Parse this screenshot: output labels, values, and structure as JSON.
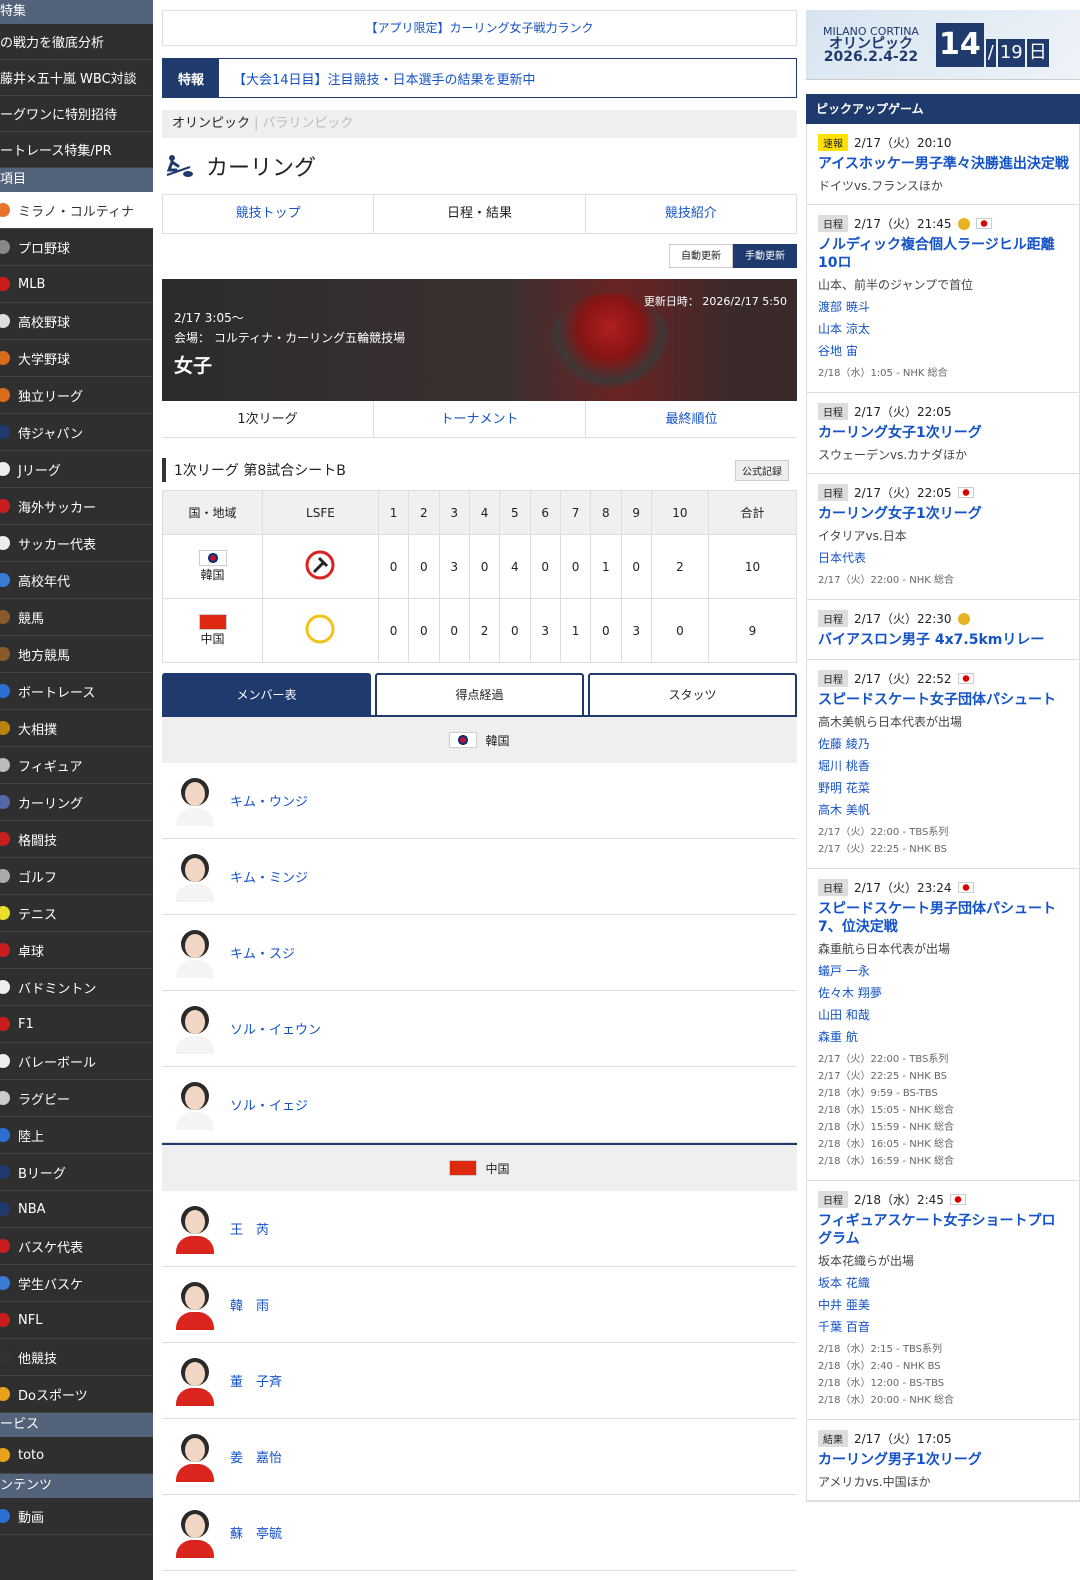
{
  "sidebar": {
    "head1": "特集",
    "features": [
      "の戦力を徹底分析",
      "藤井×五十嵐 WBC対談",
      "ーグワンに特別招待",
      "ートレース特集/PR"
    ],
    "head2": "項目",
    "items": [
      {
        "label": "ミラノ・コルティナ",
        "color": "#e8732a",
        "active": true
      },
      {
        "label": "プロ野球",
        "color": "#888"
      },
      {
        "label": "MLB",
        "color": "#c81e1e"
      },
      {
        "label": "高校野球",
        "color": "#ddd"
      },
      {
        "label": "大学野球",
        "color": "#d96c1c"
      },
      {
        "label": "独立リーグ",
        "color": "#d96c1c"
      },
      {
        "label": "侍ジャパン",
        "color": "#1f3a6d"
      },
      {
        "label": "Jリーグ",
        "color": "#eee"
      },
      {
        "label": "海外サッカー",
        "color": "#c81e1e"
      },
      {
        "label": "サッカー代表",
        "color": "#eee"
      },
      {
        "label": "高校年代",
        "color": "#3a7bd5"
      },
      {
        "label": "競馬",
        "color": "#8b5a2b"
      },
      {
        "label": "地方競馬",
        "color": "#8b5a2b"
      },
      {
        "label": "ボートレース",
        "color": "#2a6fd1"
      },
      {
        "label": "大相撲",
        "color": "#b8860b"
      },
      {
        "label": "フィギュア",
        "color": "#bbb"
      },
      {
        "label": "カーリング",
        "color": "#5566aa"
      },
      {
        "label": "格闘技",
        "color": "#c81e1e"
      },
      {
        "label": "ゴルフ",
        "color": "#aaa"
      },
      {
        "label": "テニス",
        "color": "#e8e02a"
      },
      {
        "label": "卓球",
        "color": "#c81e1e"
      },
      {
        "label": "バドミントン",
        "color": "#eee"
      },
      {
        "label": "F1",
        "color": "#c81e1e"
      },
      {
        "label": "バレーボール",
        "color": "#eee"
      },
      {
        "label": "ラグビー",
        "color": "#ccc"
      },
      {
        "label": "陸上",
        "color": "#2a6fd1"
      },
      {
        "label": "Bリーグ",
        "color": "#1f3a6d"
      },
      {
        "label": "NBA",
        "color": "#1f3a6d"
      },
      {
        "label": "バスケ代表",
        "color": "#c81e1e"
      },
      {
        "label": "学生バスケ",
        "color": "#3a7bd5"
      },
      {
        "label": "NFL",
        "color": "#c81e1e"
      },
      {
        "label": "他競技",
        "color": "#333"
      },
      {
        "label": "Doスポーツ",
        "color": "#e8a21c"
      }
    ],
    "head3": "ービス",
    "toto": "toto",
    "head4": "ンテンツ",
    "video": "動画"
  },
  "main": {
    "promo": "【アプリ限定】カーリング女子戦力ランク",
    "toku_label": "特報",
    "toku_text": "【大会14日目】注目競技・日本選手の結果を更新中",
    "oly_on": "オリンピック",
    "oly_sep": "|",
    "oly_off": "パラリンピック",
    "sport": "カーリング",
    "subnav": [
      "競技トップ",
      "日程・結果",
      "競技紹介"
    ],
    "auto": "自動更新",
    "manual": "手動更新",
    "banner": {
      "updated": "更新日時： 2026/2/17 5:50",
      "date": "2/17 3:05〜",
      "venue": "会場： コルティナ・カーリング五輪競技場",
      "title": "女子"
    },
    "rounds": [
      "1次リーグ",
      "トーナメント",
      "最終順位"
    ],
    "game_title": "1次リーグ 第8試合シートB",
    "official": "公式記録",
    "score_head": [
      "国・地域",
      "LSFE",
      "1",
      "2",
      "3",
      "4",
      "5",
      "6",
      "7",
      "8",
      "9",
      "10",
      "合計"
    ],
    "teams": [
      {
        "name": "韓国",
        "ends": [
          "0",
          "0",
          "3",
          "0",
          "4",
          "0",
          "0",
          "1",
          "0",
          "2"
        ],
        "total": "10"
      },
      {
        "name": "中国",
        "ends": [
          "0",
          "0",
          "0",
          "2",
          "0",
          "3",
          "1",
          "0",
          "3",
          "0"
        ],
        "total": "9"
      }
    ],
    "mtabs": [
      "メンバー表",
      "得点経過",
      "スタッツ"
    ],
    "korea_label": "韓国",
    "korea": [
      "キム・ウンジ",
      "キム・ミンジ",
      "キム・スジ",
      "ソル・イェウン",
      "ソル・イェジ"
    ],
    "china_label": "中国",
    "china": [
      "王　芮",
      "韓　雨",
      "董　子斉",
      "姜　嘉怡",
      "蘇　亭毓"
    ]
  },
  "right": {
    "mc_line1": "MILANO CORTINA",
    "mc_line2": "オリンピック",
    "mc_line3": "2026.2.4-22",
    "day": "14",
    "total_days": "19",
    "day_unit": "日",
    "pick_title": "ピックアップゲーム",
    "games": [
      {
        "tag": "速報",
        "tag_yellow": true,
        "time": "2/17（火）20:10",
        "title": "アイスホッケー男子準々決勝進出決定戦",
        "sub": "ドイツvs.フランスほか",
        "players": [],
        "bc": []
      },
      {
        "tag": "日程",
        "time": "2/17（火）21:45",
        "medal": true,
        "jp": true,
        "title": "ノルディック複合個人ラージヒル距離10ロ",
        "sub": "山本、前半のジャンプで首位",
        "players": [
          "渡部 暁斗",
          "山本 涼太",
          "谷地 宙"
        ],
        "bc": [
          "2/18（水）1:05 - NHK 総合"
        ]
      },
      {
        "tag": "日程",
        "time": "2/17（火）22:05",
        "title": "カーリング女子1次リーグ",
        "sub": "スウェーデンvs.カナダほか",
        "players": [],
        "bc": []
      },
      {
        "tag": "日程",
        "time": "2/17（火）22:05",
        "jp": true,
        "title": "カーリング女子1次リーグ",
        "sub": "イタリアvs.日本",
        "players": [
          "日本代表"
        ],
        "bc": [
          "2/17（火）22:00 - NHK 総合"
        ]
      },
      {
        "tag": "日程",
        "time": "2/17（火）22:30",
        "medal": true,
        "title": "バイアスロン男子 4x7.5kmリレー",
        "sub": "",
        "players": [],
        "bc": []
      },
      {
        "tag": "日程",
        "time": "2/17（火）22:52",
        "jp": true,
        "title": "スピードスケート女子団体パシュート",
        "sub": "高木美帆ら日本代表が出場",
        "players": [
          "佐藤 綾乃",
          "堀川 桃香",
          "野明 花菜",
          "高木 美帆"
        ],
        "bc": [
          "2/17（火）22:00 - TBS系列",
          "2/17（火）22:25 - NHK BS"
        ]
      },
      {
        "tag": "日程",
        "time": "2/17（火）23:24",
        "jp": true,
        "title": "スピードスケート男子団体パシュート7、位決定戦",
        "sub": "森重航ら日本代表が出場",
        "players": [
          "蟻戸 一永",
          "佐々木 翔夢",
          "山田 和哉",
          "森重 航"
        ],
        "bc": [
          "2/17（火）22:00 - TBS系列",
          "2/17（火）22:25 - NHK BS",
          "2/18（水）9:59 - BS-TBS",
          "2/18（水）15:05 - NHK 総合",
          "2/18（水）15:59 - NHK 総合",
          "2/18（水）16:05 - NHK 総合",
          "2/18（水）16:59 - NHK 総合"
        ]
      },
      {
        "tag": "日程",
        "time": "2/18（水）2:45",
        "jp": true,
        "title": "フィギュアスケート女子ショートプログラム",
        "sub": "坂本花織らが出場",
        "players": [
          "坂本 花織",
          "中井 亜美",
          "千葉 百音"
        ],
        "bc": [
          "2/18（水）2:15 - TBS系列",
          "2/18（水）2:40 - NHK BS",
          "2/18（水）12:00 - BS-TBS",
          "2/18（水）20:00 - NHK 総合"
        ]
      },
      {
        "tag": "結果",
        "time": "2/17（火）17:05",
        "title": "カーリング男子1次リーグ",
        "sub": "アメリカvs.中国ほか",
        "players": [],
        "bc": []
      }
    ]
  }
}
